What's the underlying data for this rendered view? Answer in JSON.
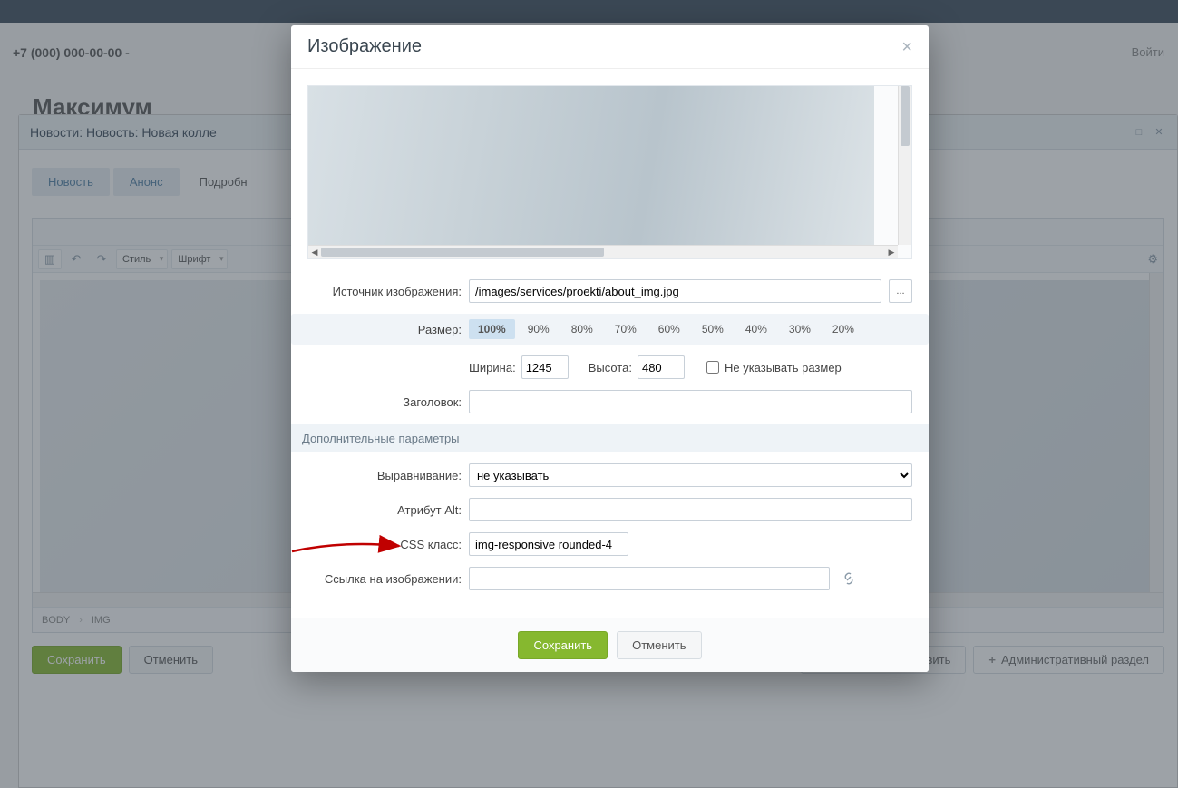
{
  "background": {
    "phone": "+7 (000) 000-00-00 -",
    "site_title": "Максимум",
    "login": "Войти"
  },
  "panel": {
    "title": "Новости: Новость: Новая колле",
    "tabs": [
      "Новость",
      "Анонс",
      "Подробн"
    ],
    "toolbar": {
      "style": "Стиль",
      "font": "Шрифт"
    },
    "path": [
      "BODY",
      "IMG"
    ],
    "buttons": {
      "save": "Сохранить",
      "cancel": "Отменить",
      "save_add": "Сохранить и добавить",
      "admin": "Административный раздел"
    }
  },
  "modal": {
    "title": "Изображение",
    "fields": {
      "source_label": "Источник изображения:",
      "source_value": "/images/services/proekti/about_img.jpg",
      "file_btn": "...",
      "size_label": "Размер:",
      "sizes": [
        "100%",
        "90%",
        "80%",
        "70%",
        "60%",
        "50%",
        "40%",
        "30%",
        "20%"
      ],
      "size_active": "100%",
      "width_label": "Ширина:",
      "width_value": "1245",
      "height_label": "Высота:",
      "height_value": "480",
      "nosize_label": "Не указывать размер",
      "title_label": "Заголовок:",
      "title_value": "",
      "section_additional": "Дополнительные параметры",
      "align_label": "Выравнивание:",
      "align_value": "не указывать",
      "alt_label": "Атрибут Alt:",
      "alt_value": "",
      "css_label": "CSS класс:",
      "css_value": "img-responsive rounded-4",
      "link_label": "Ссылка на изображении:",
      "link_value": ""
    },
    "footer": {
      "save": "Сохранить",
      "cancel": "Отменить"
    }
  }
}
